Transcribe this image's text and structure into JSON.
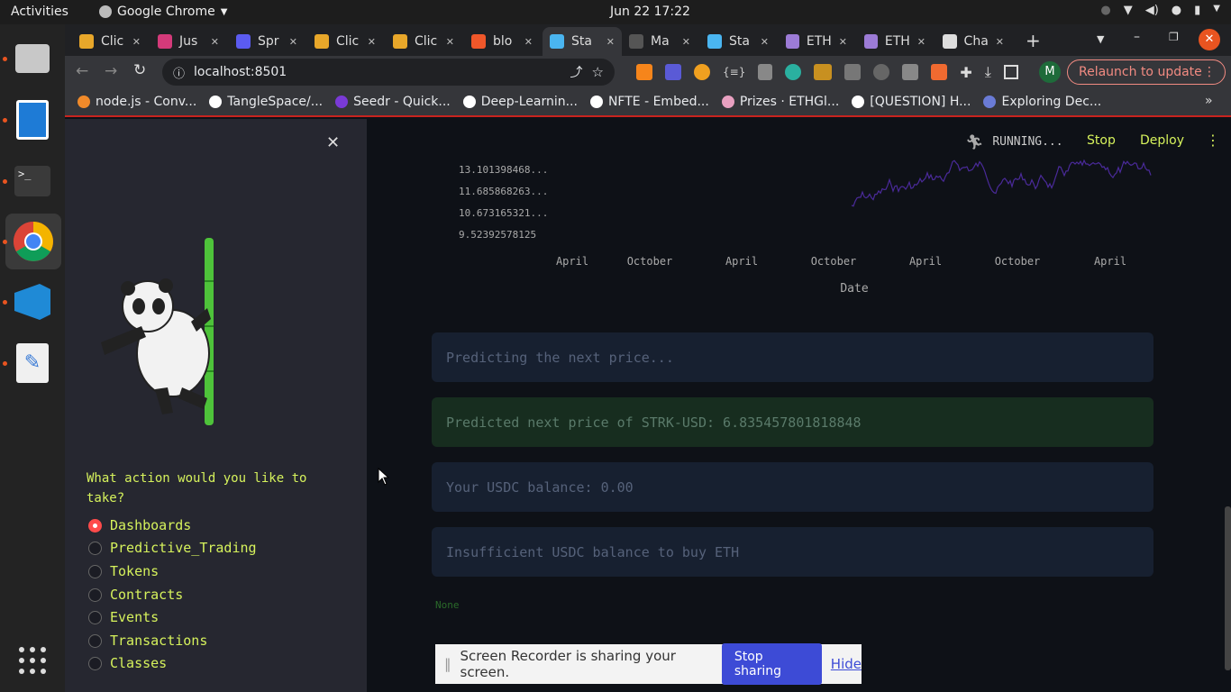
{
  "system": {
    "activities": "Activities",
    "app_name": "Google Chrome",
    "clock": "Jun 22  17:22"
  },
  "tabs": [
    {
      "label": "Clic",
      "color": "#e8a72a",
      "icon": "stripes-icon"
    },
    {
      "label": "Jus",
      "color": "#d43a7a",
      "icon": "slack-icon"
    },
    {
      "label": "Spr",
      "color": "#5b5bf0",
      "icon": "swirl-icon"
    },
    {
      "label": "Clic",
      "color": "#e8a72a",
      "icon": "stripes-icon"
    },
    {
      "label": "Clic",
      "color": "#e8a72a",
      "icon": "stripes-icon"
    },
    {
      "label": "blo",
      "color": "#f0572a",
      "icon": "blog-icon"
    },
    {
      "label": "Sta",
      "color": "#4ab5f0",
      "icon": "snowflake-icon"
    },
    {
      "label": "Ma",
      "color": "#555555",
      "icon": "mail-icon"
    },
    {
      "label": "Sta",
      "color": "#4ab5f0",
      "icon": "snowflake-icon"
    },
    {
      "label": "ETH",
      "color": "#9c7bd6",
      "icon": "eth-icon"
    },
    {
      "label": "ETH",
      "color": "#9c7bd6",
      "icon": "eth-icon"
    },
    {
      "label": "Cha",
      "color": "#dddddd",
      "icon": "chatgpt-icon"
    }
  ],
  "active_tab_index": 6,
  "toolbar": {
    "url": "localhost:8501",
    "profile_initial": "M",
    "relaunch_label": "Relaunch to update"
  },
  "bookmarks": [
    {
      "label": "node.js - Conv...",
      "color": "#f08a2a"
    },
    {
      "label": "TangleSpace/...",
      "color": "#ffffff"
    },
    {
      "label": "Seedr - Quick...",
      "color": "#7a3ad6"
    },
    {
      "label": "Deep-Learnin...",
      "color": "#ffffff"
    },
    {
      "label": "NFTE - Embed...",
      "color": "#ffffff"
    },
    {
      "label": "Prizes · ETHGl...",
      "color": "#e8a0c0"
    },
    {
      "label": "[QUESTION] H...",
      "color": "#ffffff"
    },
    {
      "label": "Exploring Dec...",
      "color": "#6a7bd6"
    }
  ],
  "streamlit": {
    "status": "RUNNING...",
    "stop_label": "Stop",
    "deploy_label": "Deploy"
  },
  "sidebar": {
    "question": "What action would you like to take?",
    "options": [
      "Dashboards",
      "Predictive_Trading",
      "Tokens",
      "Contracts",
      "Events",
      "Transactions",
      "Classes"
    ],
    "selected_index": 0
  },
  "chart_data": {
    "type": "line",
    "series_color": "#4a2a9a",
    "y_tick_labels": [
      "13.101398468...",
      "11.685868263...",
      "10.673165321...",
      "9.52392578125"
    ],
    "x_tick_labels": [
      "April",
      "October",
      "April",
      "October",
      "April",
      "October",
      "April"
    ],
    "xlabel": "Date",
    "ylabel": "",
    "grid": false,
    "legend": "none"
  },
  "messages": [
    {
      "text": "Predicting the next price...",
      "kind": "info"
    },
    {
      "text": "Predicted next price of STRK-USD: 6.835457801818848",
      "kind": "success"
    },
    {
      "text": "Your USDC balance: 0.00",
      "kind": "info"
    },
    {
      "text": "Insufficient USDC balance to buy ETH",
      "kind": "info"
    }
  ],
  "none_text": "None",
  "screen_share": {
    "message": "Screen Recorder is sharing your screen.",
    "stop_label": "Stop sharing",
    "hide_label": "Hide"
  }
}
